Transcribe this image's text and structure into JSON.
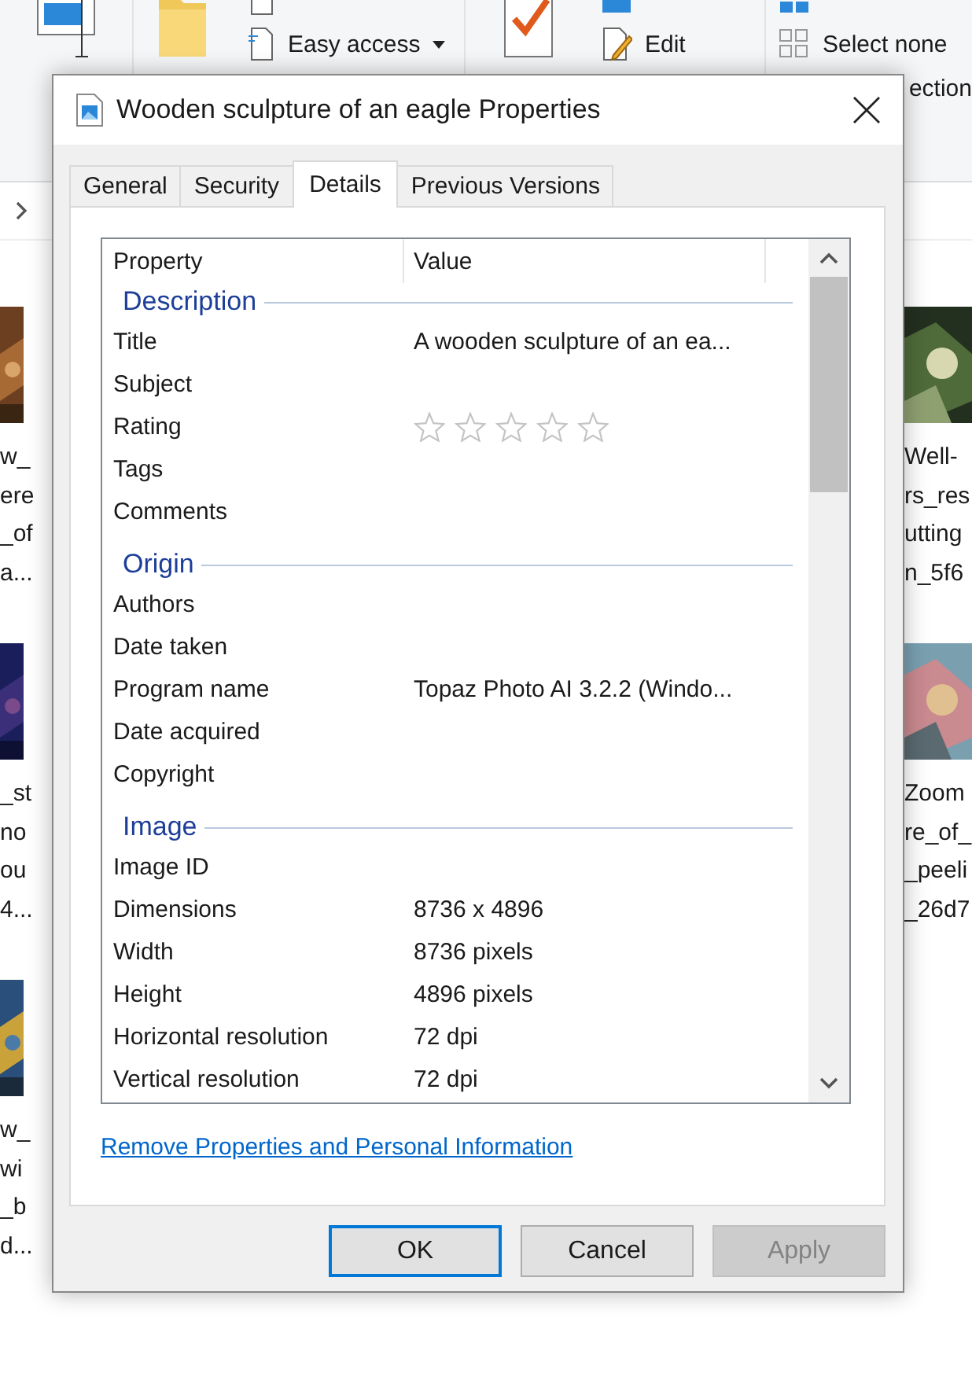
{
  "ribbon": {
    "easy_access": "Easy access",
    "edit": "Edit",
    "select_none": "Select none",
    "invert_selection": "ection"
  },
  "files_left": [
    {
      "lines": [
        "w_",
        "ere",
        "_of",
        "a..."
      ],
      "kind": "picture"
    },
    {
      "lines": [
        "_st",
        "no",
        "ou",
        "4..."
      ],
      "kind": "picture"
    },
    {
      "lines": [
        "w_",
        "wi",
        "_b",
        "d..."
      ],
      "kind": "picture"
    }
  ],
  "files_right": [
    {
      "lines": [
        "Well-",
        "rs_res",
        "utting",
        "n_5f6"
      ],
      "kind": "picture"
    },
    {
      "lines": [
        "Zoom",
        "re_of_",
        "_peeli",
        "_26d7"
      ],
      "kind": "picture"
    }
  ],
  "dialog": {
    "title": "Wooden sculpture of an eagle Properties",
    "tabs": [
      {
        "label": "General",
        "selected": false
      },
      {
        "label": "Security",
        "selected": false
      },
      {
        "label": "Details",
        "selected": true
      },
      {
        "label": "Previous Versions",
        "selected": false
      }
    ],
    "columns": [
      "Property",
      "Value"
    ],
    "sections": [
      {
        "title": "Description",
        "rows": [
          {
            "kind": "text",
            "property": "Title",
            "value": "A wooden sculpture of an ea..."
          },
          {
            "kind": "text",
            "property": "Subject"
          },
          {
            "kind": "rating",
            "property": "Rating",
            "stars": 0
          },
          {
            "kind": "text",
            "property": "Tags"
          },
          {
            "kind": "text",
            "property": "Comments"
          }
        ]
      },
      {
        "title": "Origin",
        "rows": [
          {
            "kind": "text",
            "property": "Authors"
          },
          {
            "kind": "text",
            "property": "Date taken"
          },
          {
            "kind": "text",
            "property": "Program name",
            "value": "Topaz Photo AI 3.2.2 (Windo..."
          },
          {
            "kind": "text",
            "property": "Date acquired"
          },
          {
            "kind": "text",
            "property": "Copyright"
          }
        ]
      },
      {
        "title": "Image",
        "rows": [
          {
            "kind": "text",
            "property": "Image ID"
          },
          {
            "kind": "text",
            "property": "Dimensions",
            "value": "8736 x 4896"
          },
          {
            "kind": "text",
            "property": "Width",
            "value": "8736 pixels"
          },
          {
            "kind": "text",
            "property": "Height",
            "value": "4896 pixels"
          },
          {
            "kind": "text",
            "property": "Horizontal resolution",
            "value": "72 dpi"
          },
          {
            "kind": "text",
            "property": "Vertical resolution",
            "value": "72 dpi"
          }
        ]
      }
    ],
    "link": "Remove Properties and Personal Information",
    "buttons": [
      {
        "label": "OK",
        "kind": "default",
        "disabled": false
      },
      {
        "label": "Cancel",
        "kind": "normal",
        "disabled": false
      },
      {
        "label": "Apply",
        "kind": "normal",
        "disabled": true
      }
    ]
  }
}
